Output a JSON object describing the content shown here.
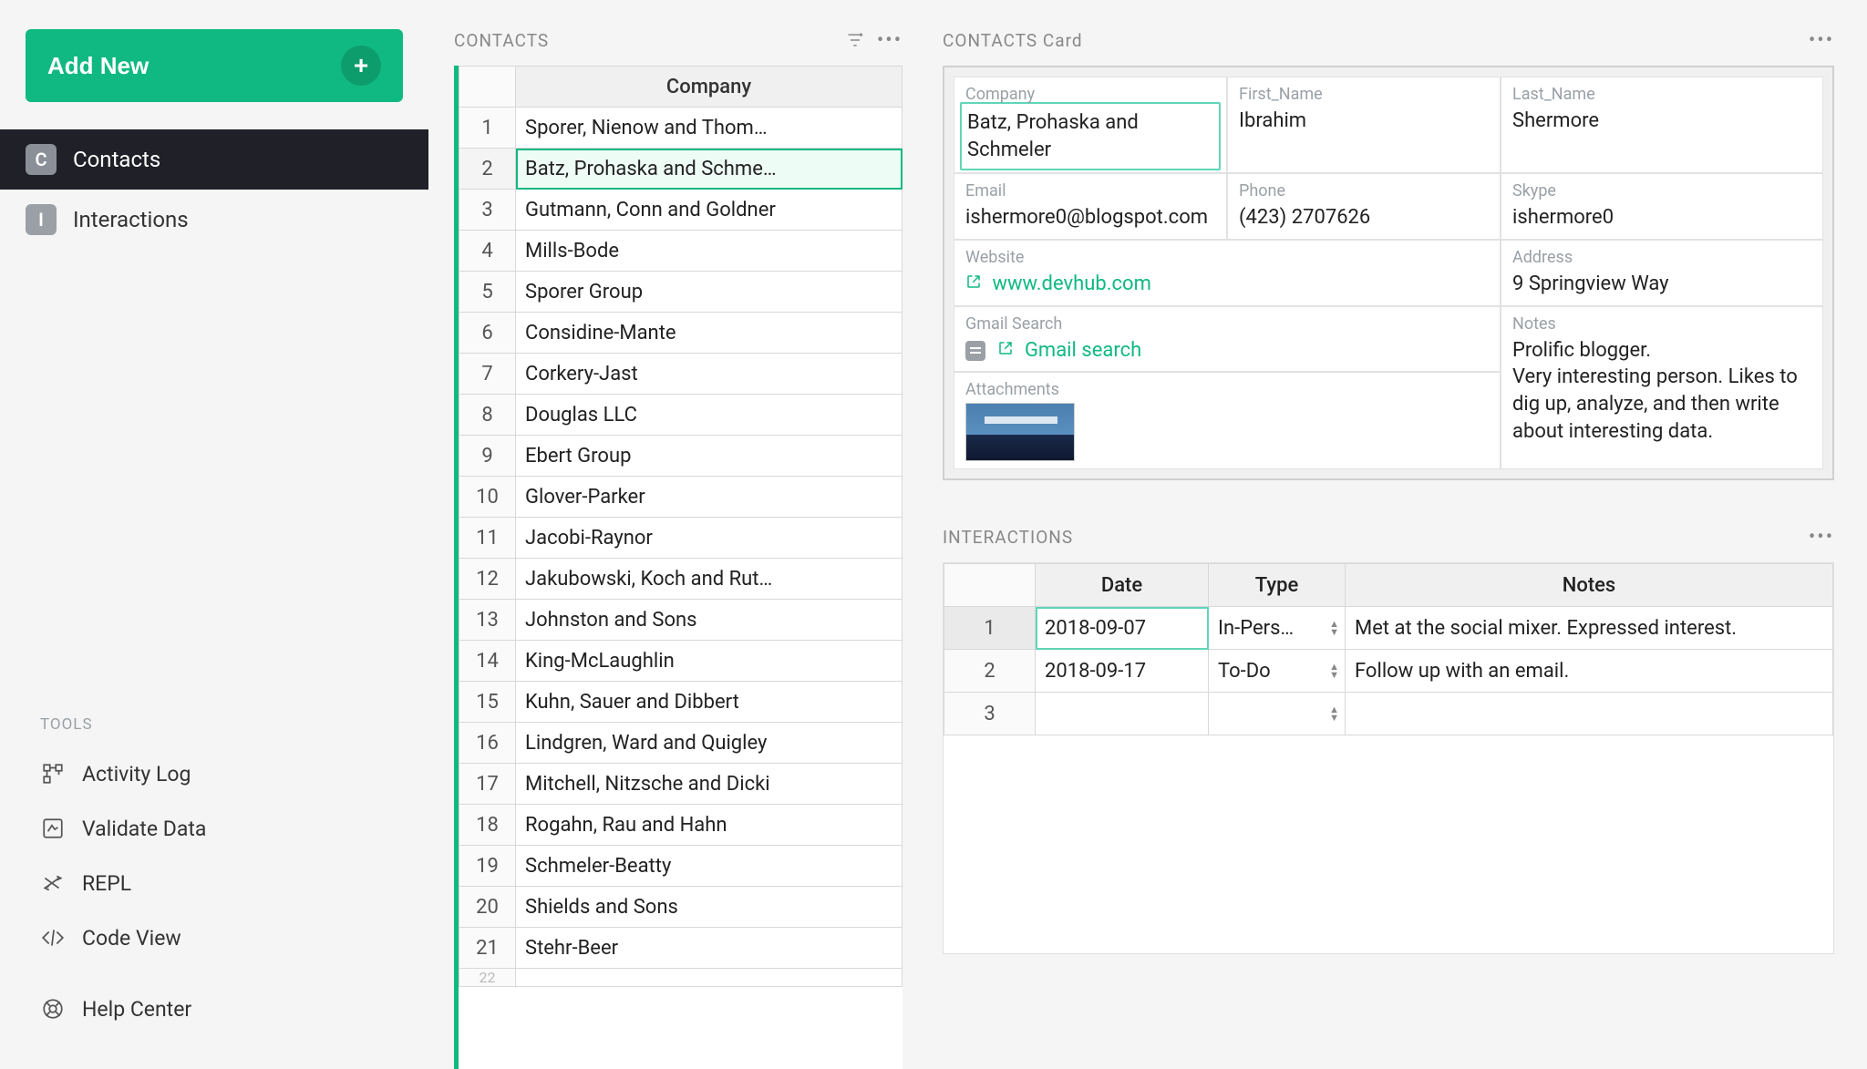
{
  "sidebar": {
    "add_new": "Add New",
    "nav": [
      {
        "badge": "C",
        "label": "Contacts",
        "active": true
      },
      {
        "badge": "I",
        "label": "Interactions",
        "active": false
      }
    ],
    "tools_label": "TOOLS",
    "tools": [
      {
        "icon": "activity",
        "label": "Activity Log"
      },
      {
        "icon": "validate",
        "label": "Validate Data"
      },
      {
        "icon": "repl",
        "label": "REPL"
      },
      {
        "icon": "code",
        "label": "Code View"
      },
      {
        "icon": "help",
        "label": "Help Center"
      }
    ]
  },
  "contacts_panel": {
    "title": "CONTACTS",
    "company_header": "Company",
    "rows": [
      "Sporer, Nienow and Thom…",
      "Batz, Prohaska and Schme…",
      "Gutmann, Conn and Goldner",
      "Mills-Bode",
      "Sporer Group",
      "Considine-Mante",
      "Corkery-Jast",
      "Douglas LLC",
      "Ebert Group",
      "Glover-Parker",
      "Jacobi-Raynor",
      "Jakubowski, Koch and Rut…",
      "Johnston and Sons",
      "King-McLaughlin",
      "Kuhn, Sauer and Dibbert",
      "Lindgren, Ward and Quigley",
      "Mitchell, Nitzsche and Dicki",
      "Rogahn, Rau and Hahn",
      "Schmeler-Beatty",
      "Shields and Sons",
      "Stehr-Beer"
    ],
    "selected_index": 1
  },
  "card": {
    "title": "CONTACTS Card",
    "fields": {
      "company": {
        "label": "Company",
        "value": "Batz, Prohaska and Schmeler"
      },
      "first_name": {
        "label": "First_Name",
        "value": "Ibrahim"
      },
      "last_name": {
        "label": "Last_Name",
        "value": "Shermore"
      },
      "email": {
        "label": "Email",
        "value": "ishermore0@blogspot.com"
      },
      "phone": {
        "label": "Phone",
        "value": "(423) 2707626"
      },
      "skype": {
        "label": "Skype",
        "value": "ishermore0"
      },
      "website": {
        "label": "Website",
        "value": "www.devhub.com"
      },
      "address": {
        "label": "Address",
        "value": "9 Springview Way"
      },
      "gmail": {
        "label": "Gmail Search",
        "value": "Gmail search"
      },
      "notes": {
        "label": "Notes",
        "value": "Prolific blogger.\nVery interesting person. Likes to dig up, analyze, and then write about interesting data."
      },
      "attachments": {
        "label": "Attachments"
      }
    }
  },
  "interactions": {
    "title": "INTERACTIONS",
    "headers": {
      "date": "Date",
      "type": "Type",
      "notes": "Notes"
    },
    "rows": [
      {
        "n": "1",
        "date": "2018-09-07",
        "type": "In-Pers…",
        "notes": "Met at the social mixer. Expressed interest."
      },
      {
        "n": "2",
        "date": "2018-09-17",
        "type": "To-Do",
        "notes": "Follow up with an email."
      },
      {
        "n": "3",
        "date": "",
        "type": "",
        "notes": ""
      }
    ],
    "selected_index": 0
  }
}
